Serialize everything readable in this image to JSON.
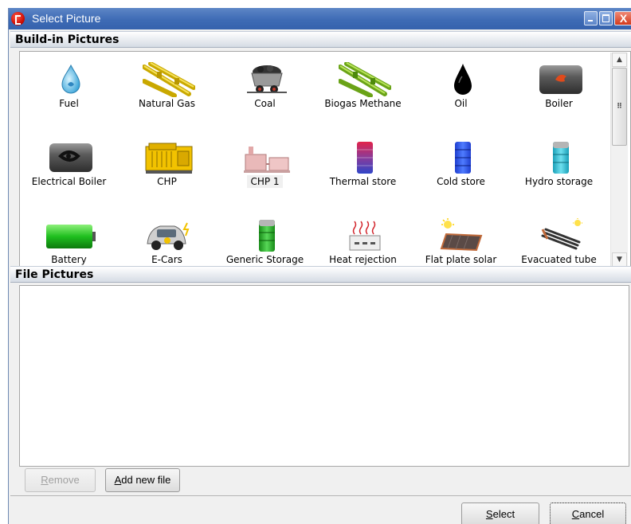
{
  "window": {
    "title": "Select Picture",
    "close_glyph": "X",
    "accent_color": "#3e6bb5"
  },
  "builtin": {
    "header": "Build-in Pictures",
    "items": [
      {
        "label": "Fuel",
        "icon": "fuel-drop-icon"
      },
      {
        "label": "Natural Gas",
        "icon": "natural-gas-pipes-icon"
      },
      {
        "label": "Coal",
        "icon": "coal-cart-icon"
      },
      {
        "label": "Biogas Methane",
        "icon": "biogas-pipes-icon"
      },
      {
        "label": "Oil",
        "icon": "oil-drop-icon"
      },
      {
        "label": "Boiler",
        "icon": "boiler-icon"
      },
      {
        "label": "Electrical Boiler",
        "icon": "electrical-boiler-icon"
      },
      {
        "label": "CHP",
        "icon": "chp-engine-icon"
      },
      {
        "label": "CHP 1",
        "icon": "chp1-plant-icon"
      },
      {
        "label": "Thermal store",
        "icon": "thermal-store-icon"
      },
      {
        "label": "Cold store",
        "icon": "cold-store-icon"
      },
      {
        "label": "Hydro storage",
        "icon": "hydro-storage-icon"
      },
      {
        "label": "Battery",
        "icon": "battery-icon"
      },
      {
        "label": "E-Cars",
        "icon": "e-car-icon"
      },
      {
        "label": "Generic Storage",
        "icon": "generic-storage-icon"
      },
      {
        "label": "Heat rejection",
        "icon": "heat-rejection-icon"
      },
      {
        "label": "Flat plate solar",
        "icon": "flat-plate-solar-icon"
      },
      {
        "label": "Evacuated tube",
        "icon": "evacuated-tube-icon"
      }
    ],
    "selected": "CHP 1"
  },
  "files": {
    "header": "File Pictures",
    "items": []
  },
  "buttons": {
    "remove_hot": "R",
    "remove_rest": "emove",
    "add_hot": "A",
    "add_rest": "dd new file",
    "select_hot": "S",
    "select_rest": "elect",
    "cancel_hot": "C",
    "cancel_rest": "ancel"
  }
}
